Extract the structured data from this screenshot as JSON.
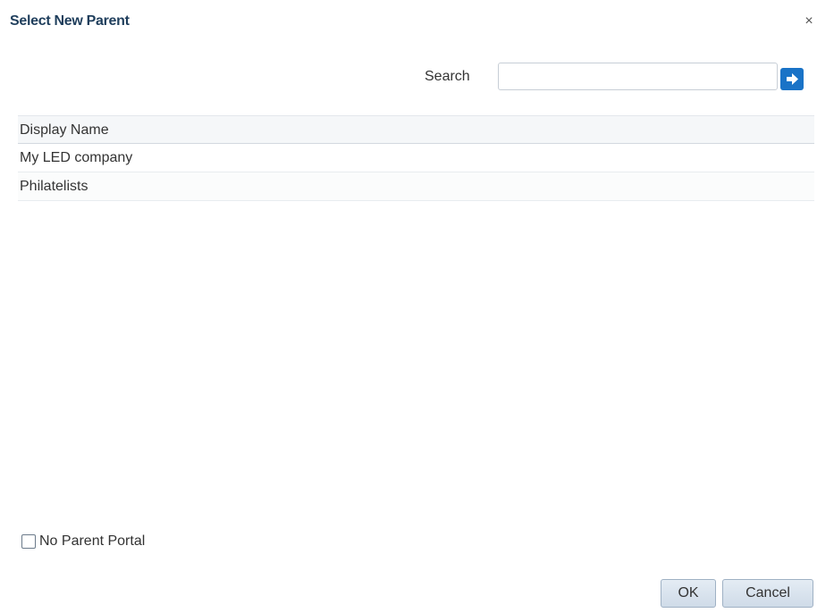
{
  "dialog": {
    "title": "Select New Parent",
    "close_glyph": "×"
  },
  "search": {
    "label": "Search",
    "value": "",
    "placeholder": "",
    "go_icon": "arrow-right-icon",
    "accent_color": "#1a73c7"
  },
  "table": {
    "columns": [
      "Display Name"
    ],
    "rows": [
      {
        "display_name": "My LED company"
      },
      {
        "display_name": "Philatelists"
      }
    ]
  },
  "options": {
    "no_parent_label": "No Parent Portal",
    "no_parent_checked": false
  },
  "buttons": {
    "ok": "OK",
    "cancel": "Cancel"
  }
}
